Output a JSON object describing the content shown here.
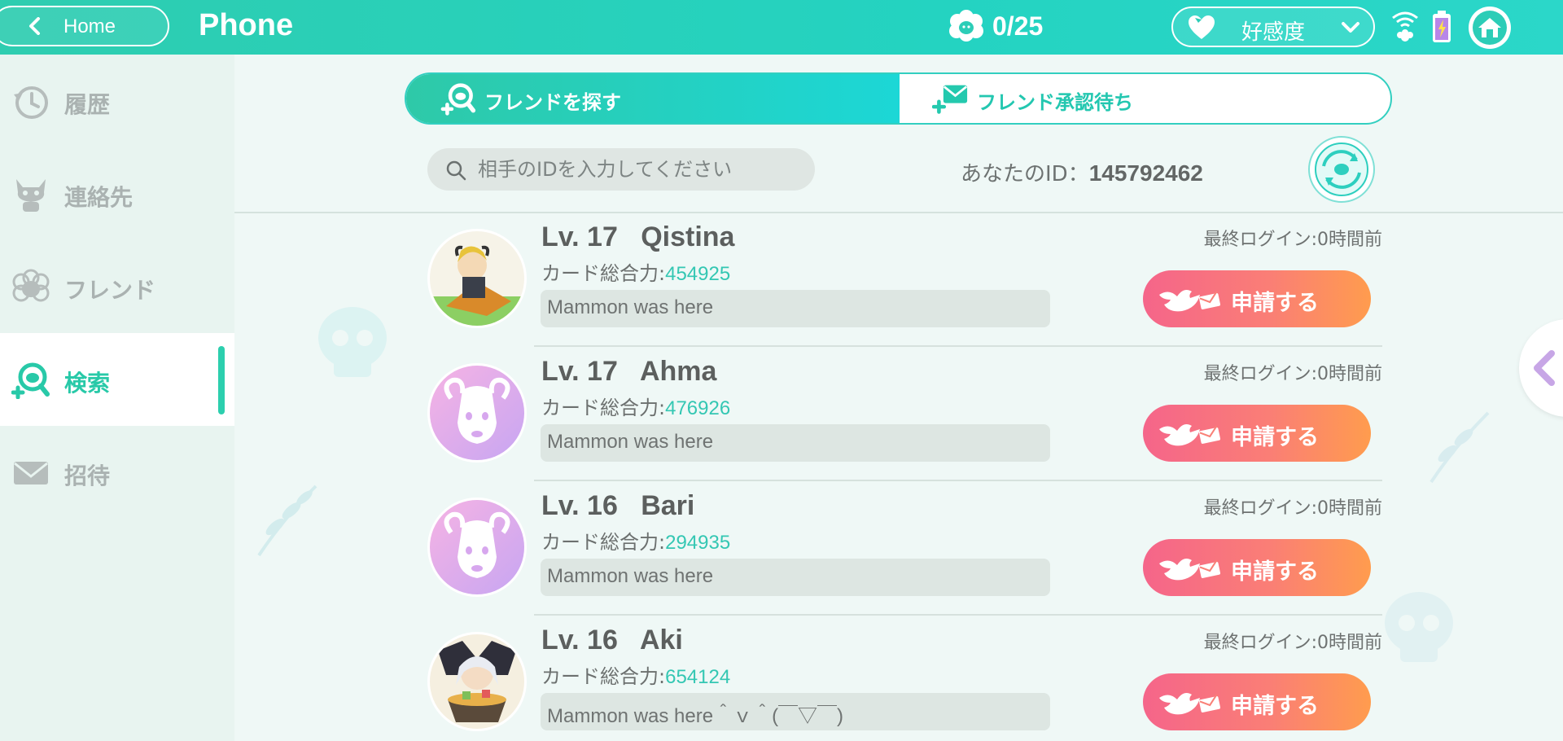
{
  "header": {
    "back_label": "Home",
    "title": "Phone",
    "counter": "0/25",
    "affinity_label": "好感度"
  },
  "sidebar": {
    "items": [
      {
        "label": "履歴",
        "icon": "history-icon"
      },
      {
        "label": "連絡先",
        "icon": "contacts-icon"
      },
      {
        "label": "フレンド",
        "icon": "friends-icon"
      },
      {
        "label": "検索",
        "icon": "search-friend-icon",
        "active": true
      },
      {
        "label": "招待",
        "icon": "invite-mail-icon"
      }
    ]
  },
  "tabs": {
    "find": "フレンドを探す",
    "pending": "フレンド承認待ち"
  },
  "search": {
    "placeholder": "相手のIDを入力してください",
    "value": ""
  },
  "my_id": {
    "label": "あなたのID：",
    "value": "145792462"
  },
  "results": [
    {
      "name": "Lv. 17   Qistina",
      "power_label": "カード総合力:",
      "power": "454925",
      "message": "Mammon was here",
      "last_login": "最終ログイン:0時間前",
      "apply": "申請する",
      "avatar": "character-avatar"
    },
    {
      "name": "Lv. 17   Ahma",
      "power_label": "カード総合力:",
      "power": "476926",
      "message": "Mammon was here",
      "last_login": "最終ログイン:0時間前",
      "apply": "申請する",
      "avatar": "sheep-avatar"
    },
    {
      "name": "Lv. 16   Bari",
      "power_label": "カード総合力:",
      "power": "294935",
      "message": "Mammon was here",
      "last_login": "最終ログイン:0時間前",
      "apply": "申請する",
      "avatar": "sheep-avatar"
    },
    {
      "name": "Lv. 16   Aki",
      "power_label": "カード総合力:",
      "power": "654124",
      "message": "Mammon was here＾ｖ＾(￣▽￣)",
      "last_login": "最終ログイン:0時間前",
      "apply": "申請する",
      "avatar": "character-avatar"
    }
  ],
  "colors": {
    "accent": "#2ecdb0",
    "apply_start": "#f5658a",
    "apply_end": "#ff9c4e",
    "power_value": "#34c7b3"
  }
}
